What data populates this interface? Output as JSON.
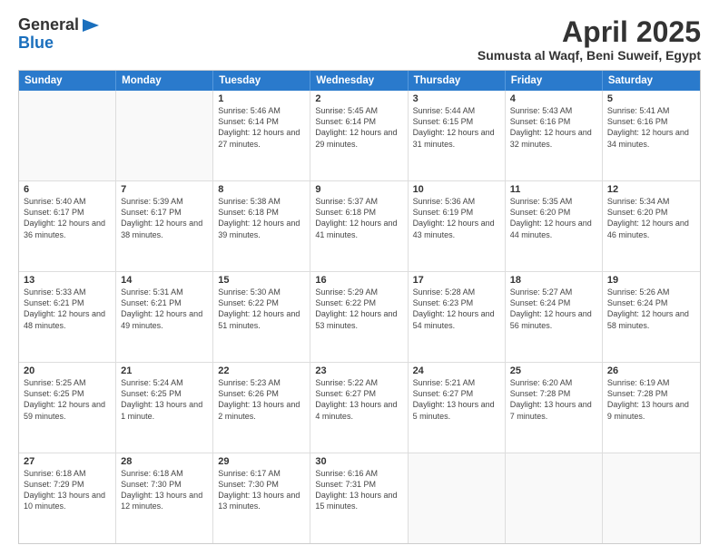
{
  "header": {
    "logo_general": "General",
    "logo_blue": "Blue",
    "month": "April 2025",
    "location": "Sumusta al Waqf, Beni Suweif, Egypt"
  },
  "weekdays": [
    "Sunday",
    "Monday",
    "Tuesday",
    "Wednesday",
    "Thursday",
    "Friday",
    "Saturday"
  ],
  "rows": [
    [
      {
        "day": "",
        "text": ""
      },
      {
        "day": "",
        "text": ""
      },
      {
        "day": "1",
        "text": "Sunrise: 5:46 AM\nSunset: 6:14 PM\nDaylight: 12 hours and 27 minutes."
      },
      {
        "day": "2",
        "text": "Sunrise: 5:45 AM\nSunset: 6:14 PM\nDaylight: 12 hours and 29 minutes."
      },
      {
        "day": "3",
        "text": "Sunrise: 5:44 AM\nSunset: 6:15 PM\nDaylight: 12 hours and 31 minutes."
      },
      {
        "day": "4",
        "text": "Sunrise: 5:43 AM\nSunset: 6:16 PM\nDaylight: 12 hours and 32 minutes."
      },
      {
        "day": "5",
        "text": "Sunrise: 5:41 AM\nSunset: 6:16 PM\nDaylight: 12 hours and 34 minutes."
      }
    ],
    [
      {
        "day": "6",
        "text": "Sunrise: 5:40 AM\nSunset: 6:17 PM\nDaylight: 12 hours and 36 minutes."
      },
      {
        "day": "7",
        "text": "Sunrise: 5:39 AM\nSunset: 6:17 PM\nDaylight: 12 hours and 38 minutes."
      },
      {
        "day": "8",
        "text": "Sunrise: 5:38 AM\nSunset: 6:18 PM\nDaylight: 12 hours and 39 minutes."
      },
      {
        "day": "9",
        "text": "Sunrise: 5:37 AM\nSunset: 6:18 PM\nDaylight: 12 hours and 41 minutes."
      },
      {
        "day": "10",
        "text": "Sunrise: 5:36 AM\nSunset: 6:19 PM\nDaylight: 12 hours and 43 minutes."
      },
      {
        "day": "11",
        "text": "Sunrise: 5:35 AM\nSunset: 6:20 PM\nDaylight: 12 hours and 44 minutes."
      },
      {
        "day": "12",
        "text": "Sunrise: 5:34 AM\nSunset: 6:20 PM\nDaylight: 12 hours and 46 minutes."
      }
    ],
    [
      {
        "day": "13",
        "text": "Sunrise: 5:33 AM\nSunset: 6:21 PM\nDaylight: 12 hours and 48 minutes."
      },
      {
        "day": "14",
        "text": "Sunrise: 5:31 AM\nSunset: 6:21 PM\nDaylight: 12 hours and 49 minutes."
      },
      {
        "day": "15",
        "text": "Sunrise: 5:30 AM\nSunset: 6:22 PM\nDaylight: 12 hours and 51 minutes."
      },
      {
        "day": "16",
        "text": "Sunrise: 5:29 AM\nSunset: 6:22 PM\nDaylight: 12 hours and 53 minutes."
      },
      {
        "day": "17",
        "text": "Sunrise: 5:28 AM\nSunset: 6:23 PM\nDaylight: 12 hours and 54 minutes."
      },
      {
        "day": "18",
        "text": "Sunrise: 5:27 AM\nSunset: 6:24 PM\nDaylight: 12 hours and 56 minutes."
      },
      {
        "day": "19",
        "text": "Sunrise: 5:26 AM\nSunset: 6:24 PM\nDaylight: 12 hours and 58 minutes."
      }
    ],
    [
      {
        "day": "20",
        "text": "Sunrise: 5:25 AM\nSunset: 6:25 PM\nDaylight: 12 hours and 59 minutes."
      },
      {
        "day": "21",
        "text": "Sunrise: 5:24 AM\nSunset: 6:25 PM\nDaylight: 13 hours and 1 minute."
      },
      {
        "day": "22",
        "text": "Sunrise: 5:23 AM\nSunset: 6:26 PM\nDaylight: 13 hours and 2 minutes."
      },
      {
        "day": "23",
        "text": "Sunrise: 5:22 AM\nSunset: 6:27 PM\nDaylight: 13 hours and 4 minutes."
      },
      {
        "day": "24",
        "text": "Sunrise: 5:21 AM\nSunset: 6:27 PM\nDaylight: 13 hours and 5 minutes."
      },
      {
        "day": "25",
        "text": "Sunrise: 6:20 AM\nSunset: 7:28 PM\nDaylight: 13 hours and 7 minutes."
      },
      {
        "day": "26",
        "text": "Sunrise: 6:19 AM\nSunset: 7:28 PM\nDaylight: 13 hours and 9 minutes."
      }
    ],
    [
      {
        "day": "27",
        "text": "Sunrise: 6:18 AM\nSunset: 7:29 PM\nDaylight: 13 hours and 10 minutes."
      },
      {
        "day": "28",
        "text": "Sunrise: 6:18 AM\nSunset: 7:30 PM\nDaylight: 13 hours and 12 minutes."
      },
      {
        "day": "29",
        "text": "Sunrise: 6:17 AM\nSunset: 7:30 PM\nDaylight: 13 hours and 13 minutes."
      },
      {
        "day": "30",
        "text": "Sunrise: 6:16 AM\nSunset: 7:31 PM\nDaylight: 13 hours and 15 minutes."
      },
      {
        "day": "",
        "text": ""
      },
      {
        "day": "",
        "text": ""
      },
      {
        "day": "",
        "text": ""
      }
    ]
  ]
}
